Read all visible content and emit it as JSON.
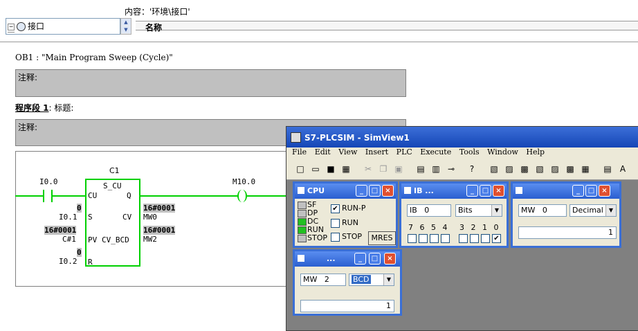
{
  "top": {
    "content_label": "内容：'环境\\接口'",
    "tree_item": "接口",
    "tree_item_partial": "",
    "name_header": "名称"
  },
  "program": {
    "ob1": "OB1 :  \"Main Program Sweep (Cycle)\"",
    "comment1": "注释:",
    "segment_title": "程序段 1",
    "segment_suffix": ": 标题:",
    "comment2": "注释:"
  },
  "ladder": {
    "contact_addr": "I0.0",
    "counter_name": "C1",
    "counter_type": "S_CU",
    "cu": "CU",
    "q": "Q",
    "s": "S",
    "cv": "CV",
    "pv": "PV",
    "cvbcd": "CV_BCD",
    "r": "R",
    "s_val": "0",
    "s_addr": "I0.1",
    "pv_val": "16#0001",
    "pv_addr": "C#1",
    "r_val": "0",
    "r_addr": "I0.2",
    "cv_val": "16#0001",
    "cv_addr": "MW0",
    "cvbcd_val": "16#0001",
    "cvbcd_addr": "MW2",
    "coil_addr": "M10.0"
  },
  "sim": {
    "title": "S7-PLCSIM - SimView1",
    "menu": [
      "File",
      "Edit",
      "View",
      "Insert",
      "PLC",
      "Execute",
      "Tools",
      "Window",
      "Help"
    ],
    "cpu": {
      "title": "CPU",
      "leds": [
        {
          "label": "SF",
          "color": "#c0c0c0"
        },
        {
          "label": "DP",
          "color": "#c0c0c0"
        },
        {
          "label": "DC",
          "color": "#22c022"
        },
        {
          "label": "RUN",
          "color": "#22c022"
        },
        {
          "label": "STOP",
          "color": "#c0c0c0"
        }
      ],
      "run_p": "RUN-P",
      "run": "RUN",
      "stop": "STOP",
      "mres": "MRES"
    },
    "ib": {
      "title": "IB   ...",
      "addr_type": "IB",
      "addr": "0",
      "format": "Bits",
      "bits": [
        "7",
        "6",
        "5",
        "4",
        "3",
        "2",
        "1",
        "0"
      ]
    },
    "mw1": {
      "title": "",
      "addr_type": "MW",
      "addr": "0",
      "format": "Decimal",
      "value": "1"
    },
    "mw2": {
      "title": "...",
      "addr_type": "MW",
      "addr": "2",
      "format": "BCD",
      "value": "1"
    }
  }
}
